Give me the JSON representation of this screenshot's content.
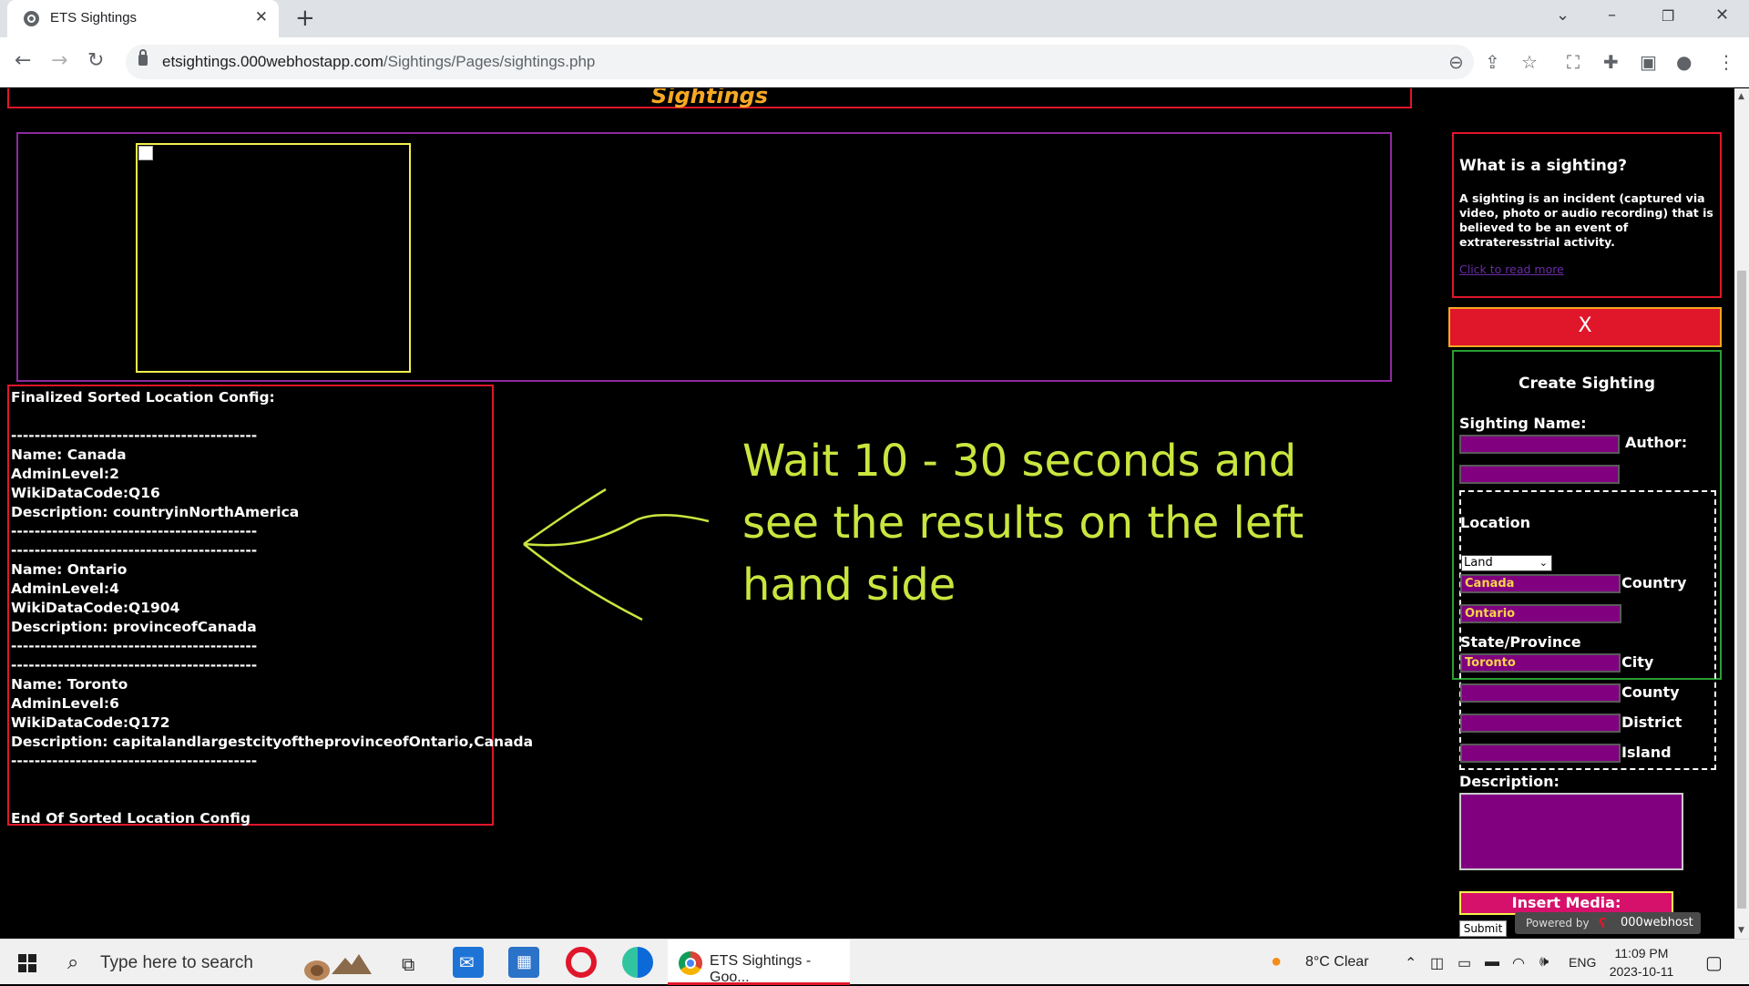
{
  "browser": {
    "tab_title": "ETS Sightings",
    "url_domain": "etsightings.000webhostapp.com",
    "url_path": "/Sightings/Pages/sightings.php"
  },
  "page": {
    "header_title": "Sightings",
    "config_text": "Finalized Sorted Location Config:\n\n------------------------------------------\nName: Canada\nAdminLevel:2\nWikiDataCode:Q16\nDescription: countryinNorthAmerica\n------------------------------------------\n------------------------------------------\nName: Ontario\nAdminLevel:4\nWikiDataCode:Q1904\nDescription: provinceofCanada\n------------------------------------------\n------------------------------------------\nName: Toronto\nAdminLevel:6\nWikiDataCode:Q172\nDescription: capitalandlargestcityoftheprovinceofOntario,Canada\n------------------------------------------\n\n\nEnd Of Sorted Location Config",
    "annotation": "Wait 10 - 30 seconds and see the results on the left hand side",
    "annotation_color": "#c8e63e"
  },
  "sidebar": {
    "what_title": "What is a sighting?",
    "what_text": "A sighting is an incident (captured via video, photo or audio recording) that is believed to be an event of extrateresstrial activity.",
    "read_more": "Click to read more",
    "close_label": "X",
    "create_title": "Create Sighting",
    "sighting_name_label": "Sighting Name:",
    "author_label": "Author:",
    "location_label": "Location",
    "location_type": "Land",
    "country_value": "Canada",
    "country_label": "Country",
    "state_value": "Ontario",
    "state_label": "State/Province",
    "city_value": "Toronto",
    "city_label": "City",
    "county_label": "County",
    "district_label": "District",
    "island_label": "Island",
    "description_label": "Description:",
    "insert_media_label": "Insert Media:",
    "submit_label": "Submit",
    "powered_by": "Powered by",
    "host_name": "000webhost"
  },
  "taskbar": {
    "search_placeholder": "Type here to search",
    "chrome_label": "ETS Sightings - Goo...",
    "weather": "8°C  Clear",
    "language": "ENG",
    "time": "11:09 PM",
    "date": "2023-10-11"
  }
}
